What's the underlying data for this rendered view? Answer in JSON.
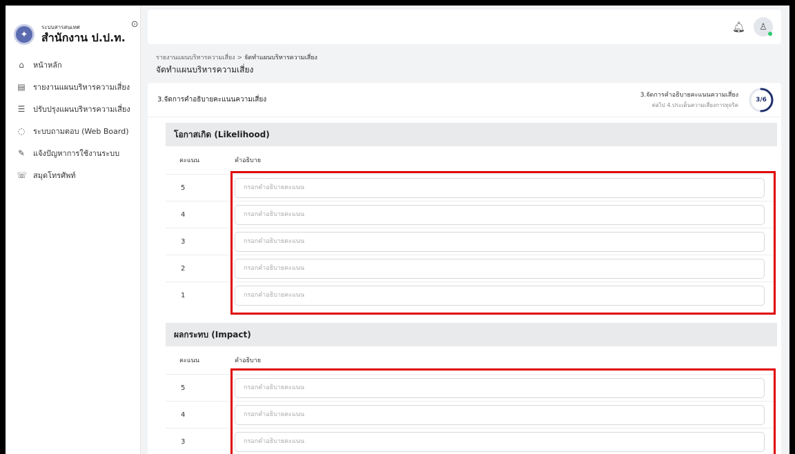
{
  "brand": {
    "subtitle": "ระบบสารสนเทศ",
    "title": "สำนักงาน ป.ป.ท."
  },
  "sidebar": {
    "items": [
      {
        "label": "หน้าหลัก",
        "icon": "home-icon"
      },
      {
        "label": "รายงานแผนบริหารความเสี่ยง",
        "icon": "document-icon"
      },
      {
        "label": "ปรับปรุงแผนบริหารความเสี่ยง",
        "icon": "list-icon"
      },
      {
        "label": "ระบบถามตอบ (Web Board)",
        "icon": "chat-icon"
      },
      {
        "label": "แจ้งปัญหาการใช้งานระบบ",
        "icon": "report-icon"
      },
      {
        "label": "สมุดโทรศัพท์",
        "icon": "phone-icon"
      }
    ]
  },
  "breadcrumb": {
    "parent": "รายงานแผนบริหารความเสี่ยง",
    "separator": ">",
    "current": "จัดทำแผนบริหารความเสี่ยง"
  },
  "page_title": "จัดทำแผนบริหารความเสี่ยง",
  "step": {
    "title": "3.จัดการคำอธิบายคะแนนความเสี่ยง",
    "current_label": "3.จัดการคำอธิบายคะแนนความเสี่ยง",
    "next_label": "ต่อไป 4.ประเด็นความเสี่ยงการทุจริต",
    "progress_text": "3/6",
    "progress_fraction": 0.5,
    "ring_color": "#1f2f6e"
  },
  "likelihood": {
    "header": "โอกาสเกิด (Likelihood)",
    "col_score": "คะแนน",
    "col_desc": "คำอธิบาย",
    "rows": [
      {
        "score": "5",
        "value": "",
        "placeholder": "กรอกคำอธิบายคะแนน"
      },
      {
        "score": "4",
        "value": "",
        "placeholder": "กรอกคำอธิบายคะแนน"
      },
      {
        "score": "3",
        "value": "",
        "placeholder": "กรอกคำอธิบายคะแนน"
      },
      {
        "score": "2",
        "value": "",
        "placeholder": "กรอกคำอธิบายคะแนน"
      },
      {
        "score": "1",
        "value": "",
        "placeholder": "กรอกคำอธิบายคะแนน"
      }
    ]
  },
  "impact": {
    "header": "ผลกระทบ (Impact)",
    "col_score": "คะแนน",
    "col_desc": "คำอธิบาย",
    "rows": [
      {
        "score": "5",
        "value": "",
        "placeholder": "กรอกคำอธิบายคะแนน"
      },
      {
        "score": "4",
        "value": "",
        "placeholder": "กรอกคำอธิบายคะแนน"
      },
      {
        "score": "3",
        "value": "",
        "placeholder": "กรอกคำอธิบายคะแนน"
      }
    ]
  },
  "colors": {
    "highlight": "#e00000",
    "section_header_bg": "#e9eaec",
    "online_status": "#2ecc71"
  }
}
